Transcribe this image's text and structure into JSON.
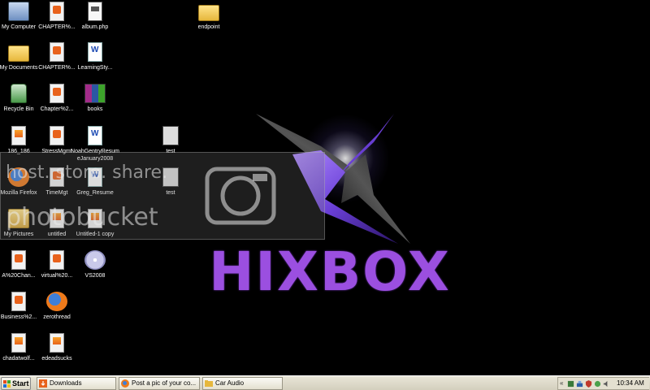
{
  "desktop_icons": [
    {
      "label": "My Computer",
      "icon": "computer-icon",
      "type": "computer"
    },
    {
      "label": "CHAPTER%...",
      "icon": "powerpoint-icon",
      "type": "doc"
    },
    {
      "label": "album.php",
      "icon": "php-file-icon",
      "type": "php"
    },
    {
      "label": "endpoint",
      "icon": "folder-icon",
      "type": "folder"
    },
    {
      "label": "My Documents",
      "icon": "folder-icon",
      "type": "folder"
    },
    {
      "label": "CHAPTER%...",
      "icon": "powerpoint-icon",
      "type": "doc"
    },
    {
      "label": "LearningSty...",
      "icon": "word-doc-icon",
      "type": "word"
    },
    {
      "label": "Recycle Bin",
      "icon": "recycle-bin-icon",
      "type": "recycle"
    },
    {
      "label": "Chapter%2...",
      "icon": "powerpoint-icon",
      "type": "doc"
    },
    {
      "label": "books",
      "icon": "archive-icon",
      "type": "books"
    },
    {
      "label": "186_186",
      "icon": "image-file-icon",
      "type": "image"
    },
    {
      "label": "StressMgmt",
      "icon": "powerpoint-icon",
      "type": "doc"
    },
    {
      "label": "NoahGentryResumeJanuary2008",
      "icon": "word-doc-icon",
      "type": "word"
    },
    {
      "label": "test",
      "icon": "program-icon",
      "type": "test-prog"
    },
    {
      "label": "Mozilla Firefox",
      "icon": "firefox-icon",
      "type": "firefox"
    },
    {
      "label": "TimeMgt",
      "icon": "powerpoint-icon",
      "type": "doc"
    },
    {
      "label": "Greg_Resume",
      "icon": "word-doc-icon",
      "type": "word"
    },
    {
      "label": "test",
      "icon": "program-icon",
      "type": "test-prog"
    },
    {
      "label": "My Pictures",
      "icon": "pictures-folder-icon",
      "type": "pictures"
    },
    {
      "label": "untitled",
      "icon": "image-file-icon",
      "type": "image"
    },
    {
      "label": "Untitled-1 copy",
      "icon": "image-file-icon",
      "type": "image"
    },
    {
      "label": "A%20Chan...",
      "icon": "powerpoint-icon",
      "type": "doc"
    },
    {
      "label": "virtual%20...",
      "icon": "powerpoint-icon",
      "type": "doc"
    },
    {
      "label": "VS2008",
      "icon": "cd-icon",
      "type": "cd"
    },
    {
      "label": "Business%2...",
      "icon": "powerpoint-icon",
      "type": "doc"
    },
    {
      "label": "zerothread",
      "icon": "firefox-icon",
      "type": "firefox"
    },
    {
      "label": "chadatwolf...",
      "icon": "image-file-icon",
      "type": "image"
    },
    {
      "label": "edeadsucks",
      "icon": "image-file-icon",
      "type": "image"
    }
  ],
  "wallpaper": {
    "brand": "HIXBOX",
    "accent": "#9b4fe0"
  },
  "watermark": {
    "text": "host. store. share.",
    "brand": "photobucket"
  },
  "taskbar": {
    "start_label": "Start",
    "tasks": [
      {
        "label": "Downloads",
        "icon": "downloads-icon"
      },
      {
        "label": "Post a pic of your co...",
        "icon": "firefox-icon"
      },
      {
        "label": "Car Audio",
        "icon": "folder-icon"
      }
    ],
    "tray_chevron": "«",
    "clock": "10:34 AM"
  }
}
